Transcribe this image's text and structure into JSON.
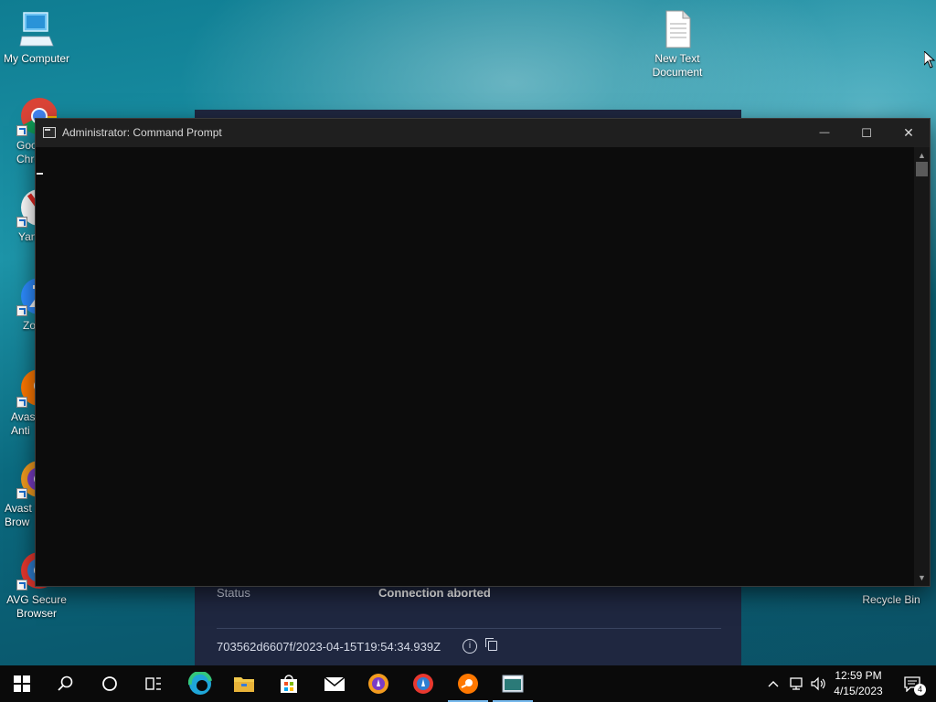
{
  "desktop": {
    "icons": [
      {
        "label": "My Computer"
      },
      {
        "label": "Goo\nChro"
      },
      {
        "label": "Yan"
      },
      {
        "label": "Zo"
      },
      {
        "label": "Avast\nAnti"
      },
      {
        "label": "Avast S\nBrow"
      },
      {
        "label": "AVG Secure\nBrowser"
      },
      {
        "label": "New Text\nDocument"
      },
      {
        "label": "Recycle Bin"
      }
    ]
  },
  "background_panel": {
    "status_label": "Status",
    "status_value": "Connection aborted",
    "connection_id": "703562d6607f/2023-04-15T19:54:34.939Z"
  },
  "cmd_window": {
    "title": "Administrator:  Command Prompt",
    "minimize_glyph": "—",
    "maximize_glyph": "☐",
    "close_glyph": "✕"
  },
  "taskbar": {
    "items": [
      "start-icon",
      "search-icon",
      "cortana-icon",
      "task-view-icon",
      "edge-icon",
      "file-explorer-icon",
      "store-icon",
      "mail-icon",
      "avast-secure-browser-icon",
      "avg-secure-browser-icon",
      "avast-antivirus-icon",
      "command-prompt-icon"
    ],
    "time": "12:59 PM",
    "date": "4/15/2023",
    "notification_count": "4"
  },
  "colors": {
    "cmd_background": "#0c0c0c",
    "panel_background": "#1f2740",
    "taskbar": "#0a0a0a",
    "accent": "#76b9ed"
  }
}
